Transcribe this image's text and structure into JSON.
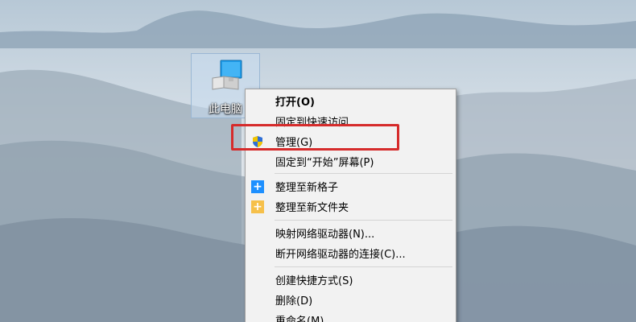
{
  "desktop": {
    "icon_label": "此电脑"
  },
  "context_menu": {
    "items": [
      {
        "label": "打开(O)",
        "bold": true,
        "icon": ""
      },
      {
        "label": "固定到快速访问",
        "icon": ""
      },
      {
        "label": "管理(G)",
        "icon": "uac-shield-icon"
      },
      {
        "label": "固定到“开始”屏幕(P)",
        "icon": ""
      },
      {
        "label": "整理至新格子",
        "icon": "blue-plus-icon"
      },
      {
        "label": "整理至新文件夹",
        "icon": "folder-plus-icon"
      },
      {
        "label": "映射网络驱动器(N)...",
        "icon": ""
      },
      {
        "label": "断开网络驱动器的连接(C)...",
        "icon": ""
      },
      {
        "label": "创建快捷方式(S)",
        "icon": ""
      },
      {
        "label": "删除(D)",
        "icon": ""
      },
      {
        "label": "重命名(M)",
        "icon": ""
      }
    ]
  },
  "colors": {
    "highlight_border": "#d62b2b",
    "menu_background": "#f2f2f2"
  }
}
